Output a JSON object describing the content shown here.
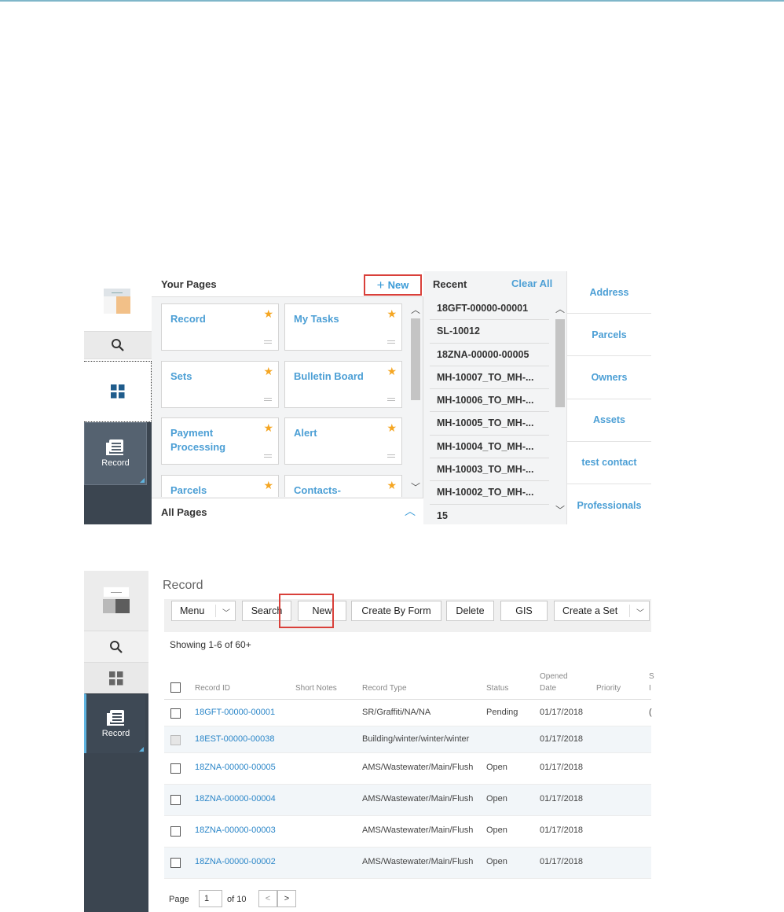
{
  "top_panel": {
    "rail": {
      "record_label": "Record"
    },
    "your_pages": {
      "title": "Your Pages",
      "new_label": "New",
      "tiles": [
        "Record",
        "My Tasks",
        "Sets",
        "Bulletin Board",
        "Payment Processing",
        "Alert",
        "Parcels",
        "Contacts-"
      ],
      "all_pages_label": "All Pages"
    },
    "recent": {
      "title": "Recent",
      "clear_label": "Clear All",
      "items": [
        "18GFT-00000-00001",
        "SL-10012",
        "18ZNA-00000-00005",
        "MH-10007_TO_MH-...",
        "MH-10006_TO_MH-...",
        "MH-10005_TO_MH-...",
        "MH-10004_TO_MH-...",
        "MH-10003_TO_MH-...",
        "MH-10002_TO_MH-...",
        "15"
      ]
    },
    "search_categories": [
      "Address",
      "Parcels",
      "Owners",
      "Assets",
      "test contact",
      "Professionals"
    ],
    "colors": {
      "accent": "#4c9fd5",
      "highlight": "#d9403a",
      "star": "#f5a623",
      "rail": "#3b4550"
    }
  },
  "bottom_panel": {
    "rail": {
      "record_label": "Record"
    },
    "title": "Record",
    "toolbar": {
      "menu": "Menu",
      "search": "Search",
      "new": "New",
      "create_by_form": "Create By Form",
      "delete": "Delete",
      "gis": "GIS",
      "create_set": "Create a Set"
    },
    "showing": "Showing 1-6 of 60+",
    "columns": {
      "record_id": "Record ID",
      "short_notes": "Short Notes",
      "record_type": "Record Type",
      "status": "Status",
      "opened_1": "Opened",
      "opened_2": "Date",
      "priority": "Priority",
      "trunc_1": "S",
      "trunc_2": "I"
    },
    "rows": [
      {
        "id": "18GFT-00000-00001",
        "type": "SR/Graffiti/NA/NA",
        "status": "Pending",
        "date": "01/17/2018",
        "extra": "("
      },
      {
        "id": "18EST-00000-00038",
        "type": "Building/winter/winter/winter",
        "status": "",
        "date": "01/17/2018",
        "extra": ""
      },
      {
        "id": "18ZNA-00000-00005",
        "type": "AMS/Wastewater/Main/Flush",
        "status": "Open",
        "date": "01/17/2018",
        "extra": ""
      },
      {
        "id": "18ZNA-00000-00004",
        "type": "AMS/Wastewater/Main/Flush",
        "status": "Open",
        "date": "01/17/2018",
        "extra": ""
      },
      {
        "id": "18ZNA-00000-00003",
        "type": "AMS/Wastewater/Main/Flush",
        "status": "Open",
        "date": "01/17/2018",
        "extra": ""
      },
      {
        "id": "18ZNA-00000-00002",
        "type": "AMS/Wastewater/Main/Flush",
        "status": "Open",
        "date": "01/17/2018",
        "extra": ""
      }
    ],
    "pager": {
      "label": "Page",
      "current": "1",
      "of": "of 10"
    }
  }
}
